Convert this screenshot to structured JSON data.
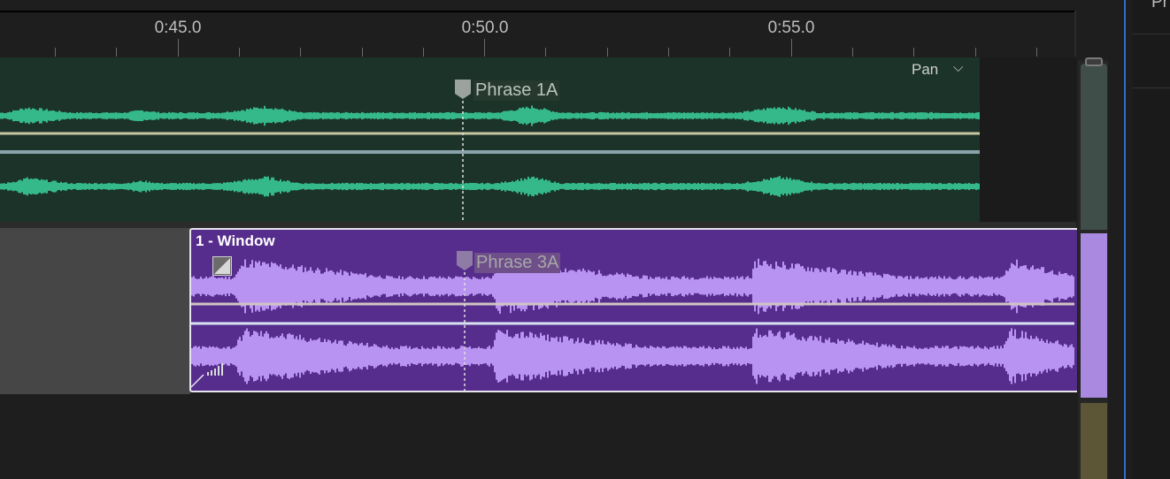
{
  "ruler": {
    "labels": [
      "0:45.0",
      "0:50.0",
      "0:55.0"
    ]
  },
  "track1": {
    "pan_label": "Pan",
    "marker_label": "Phrase 1A",
    "colors": {
      "background": "#1c3329",
      "waveform": "#35b98a"
    }
  },
  "track2": {
    "clip_title": "1 - Window",
    "marker_label": "Phrase 3A",
    "colors": {
      "background": "#562d8c",
      "waveform": "#b993f2"
    }
  },
  "right_panel": {
    "text": "Pr"
  },
  "icons": {
    "pan_chevron": "chevron-down-icon",
    "fade": "fade-handle-icon",
    "level": "volume-level-icon",
    "marker": "marker-flag-icon"
  }
}
